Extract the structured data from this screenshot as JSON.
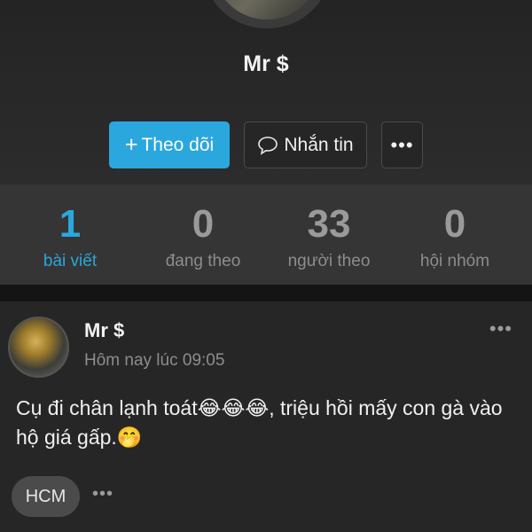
{
  "profile": {
    "name": "Mr $"
  },
  "actions": {
    "follow_icon": "+",
    "follow_label": "Theo dõi",
    "message_label": "Nhắn tin",
    "more_label": "•••"
  },
  "stats": [
    {
      "value": "1",
      "label": "bài viết"
    },
    {
      "value": "0",
      "label": "đang theo"
    },
    {
      "value": "33",
      "label": "người theo"
    },
    {
      "value": "0",
      "label": "hội nhóm"
    }
  ],
  "post": {
    "author": "Mr $",
    "time": "Hôm nay lúc 09:05",
    "menu": "•••",
    "text": "Cụ đi chân lạnh toát😂😂😂, triệu hồi mấy con gà vào hộ giá gấp.🤭",
    "tag": "HCM",
    "tag_more": "•••"
  },
  "colors": {
    "accent": "#2aa7dd",
    "background": "#1e1e1e",
    "stats_bg": "#353535",
    "post_bg": "#262626"
  },
  "icons": {
    "message": "chat-bubble-icon",
    "more": "more-dots-icon"
  }
}
